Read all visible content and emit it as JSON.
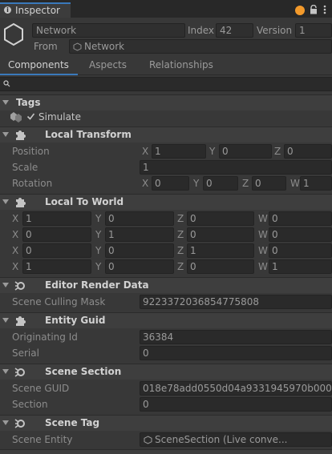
{
  "window": {
    "tab_title": "Inspector"
  },
  "header": {
    "name_value": "Network",
    "index_label": "Index",
    "index_value": "42",
    "version_label": "Version",
    "version_value": "1",
    "from_label": "From",
    "from_value": "Network"
  },
  "subtabs": [
    "Components",
    "Aspects",
    "Relationships"
  ],
  "tags": {
    "title": "Tags",
    "simulate_label": "Simulate"
  },
  "local_transform": {
    "title": "Local Transform",
    "position_label": "Position",
    "position": {
      "x": "1",
      "y": "0",
      "z": "0"
    },
    "scale_label": "Scale",
    "scale_value": "1",
    "rotation_label": "Rotation",
    "rotation": {
      "x": "0",
      "y": "0",
      "z": "0",
      "w": "1"
    }
  },
  "local_to_world": {
    "title": "Local To World",
    "rows": [
      {
        "x": "1",
        "y": "0",
        "z": "0",
        "w": "0"
      },
      {
        "x": "0",
        "y": "1",
        "z": "0",
        "w": "0"
      },
      {
        "x": "0",
        "y": "0",
        "z": "1",
        "w": "0"
      },
      {
        "x": "1",
        "y": "0",
        "z": "0",
        "w": "1"
      }
    ]
  },
  "editor_render_data": {
    "title": "Editor Render Data",
    "culling_label": "Scene Culling Mask",
    "culling_value": "9223372036854775808"
  },
  "entity_guid": {
    "title": "Entity Guid",
    "orig_label": "Originating Id",
    "orig_value": "36384",
    "serial_label": "Serial",
    "serial_value": "0"
  },
  "scene_section": {
    "title": "Scene Section",
    "guid_label": "Scene GUID",
    "guid_value": "018e78add0550d04a9331945970b0008",
    "section_label": "Section",
    "section_value": "0"
  },
  "scene_tag": {
    "title": "Scene Tag",
    "entity_label": "Scene Entity",
    "entity_value": "SceneSection (Live conve..."
  },
  "axes": {
    "x": "X",
    "y": "Y",
    "z": "Z",
    "w": "W"
  }
}
